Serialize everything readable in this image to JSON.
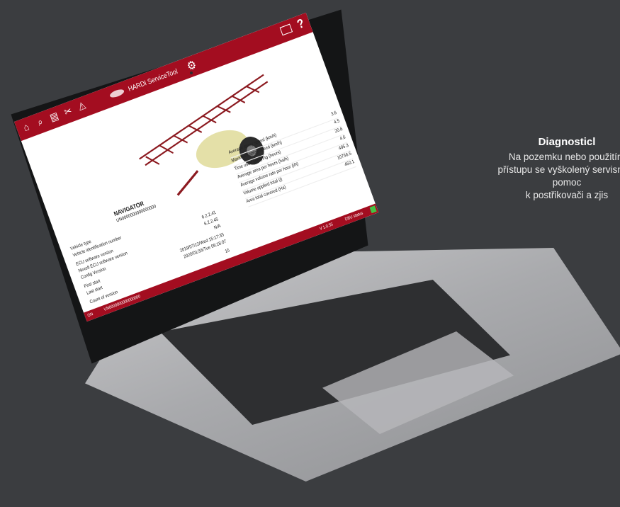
{
  "promo": {
    "heading": "Diagnosticl",
    "lines": [
      "Na pozemku nebo použitím",
      "přístupu se vyškolený servisní te",
      "pomoc",
      "k postřikovači a zjis"
    ]
  },
  "app": {
    "title": "HARDI ServiceTool",
    "toolbar_icons": [
      "home-icon",
      "search-icon",
      "document-icon",
      "tools-icon",
      "warning-icon"
    ],
    "help_label": "?",
    "accent_color": "#a30d20"
  },
  "vehicle": {
    "brand": "NAVIGATOR",
    "serial": "UN0000000000000000",
    "rows": [
      {
        "label": "Vehicle type",
        "value": ""
      },
      {
        "label": "Vehicle identification number",
        "value": ""
      },
      {
        "label": "ECU software version",
        "value": "6.2.2.41"
      },
      {
        "label": "Nexelt ECU software version",
        "value": "6.2.2.45"
      },
      {
        "label": "Config Version",
        "value": "N/A"
      },
      {
        "label": "First start",
        "value": "2019/07/12/Wed 15:17:35"
      },
      {
        "label": "Last start",
        "value": "2020/01/16/Tue 06:18:07"
      },
      {
        "label": "Count of version",
        "value": "15"
      }
    ]
  },
  "stats": {
    "rows": [
      {
        "label": "Average spray speed (km/h)",
        "value": "3.6"
      },
      {
        "label": "Maximum spray speed (km/h)",
        "value": "4.5"
      },
      {
        "label": "Time used spraying (hours)",
        "value": "20.6"
      },
      {
        "label": "Average area per hours (ha/h)",
        "value": "4.6"
      },
      {
        "label": "Average volume rate per hour (l/h)",
        "value": "495.3"
      },
      {
        "label": "Volume applied total (l)",
        "value": "10756.5"
      },
      {
        "label": "Area total covered (Ha)",
        "value": "450.1"
      }
    ]
  },
  "status_bar": {
    "left": "ON",
    "mid": "UN0000000000000000",
    "right": "V 1.0.55",
    "status": "DBU status"
  }
}
